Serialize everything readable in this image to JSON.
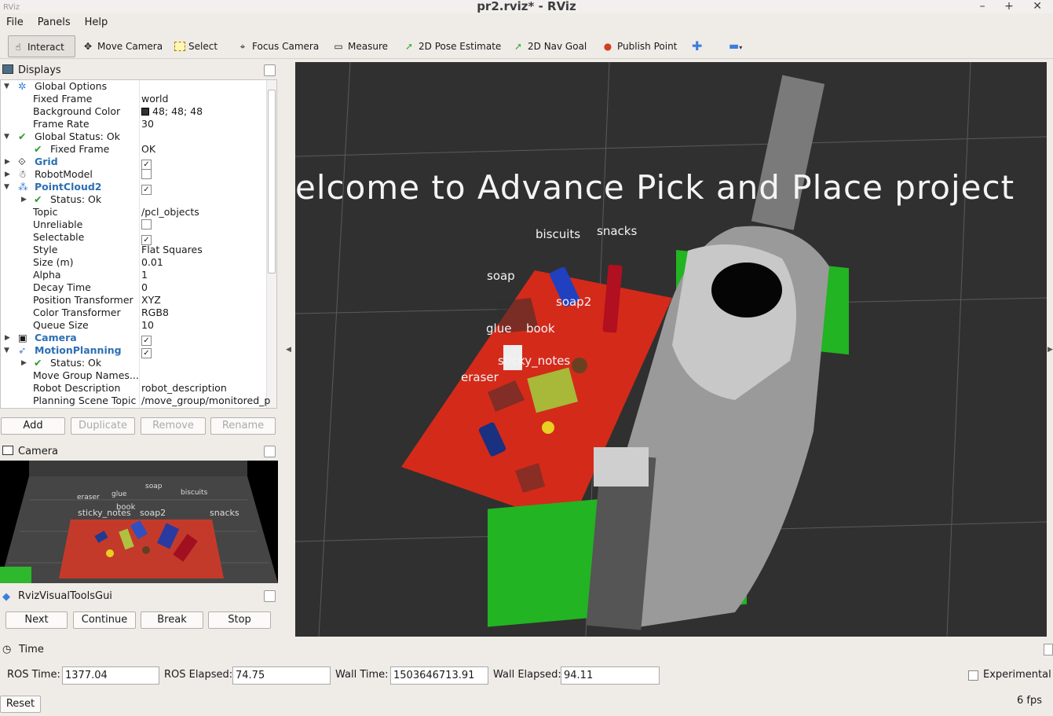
{
  "window": {
    "title": "pr2.rviz* - RViz",
    "controls": "– + ✕"
  },
  "menu": [
    "File",
    "Panels",
    "Help"
  ],
  "toolbar": {
    "interact": "Interact",
    "move_camera": "Move Camera",
    "select": "Select",
    "focus_camera": "Focus Camera",
    "measure": "Measure",
    "pose_estimate": "2D Pose Estimate",
    "nav_goal": "2D Nav Goal",
    "publish_point": "Publish Point"
  },
  "displays": {
    "title": "Displays",
    "rows": [
      {
        "name": "Global Options",
        "value": ""
      },
      {
        "name": "Fixed Frame",
        "value": "world"
      },
      {
        "name": "Background Color",
        "value": "48; 48; 48"
      },
      {
        "name": "Frame Rate",
        "value": "30"
      },
      {
        "name": "Global Status: Ok",
        "value": ""
      },
      {
        "name": "Fixed Frame",
        "value": "OK"
      },
      {
        "name": "Grid",
        "value": ""
      },
      {
        "name": "RobotModel",
        "value": ""
      },
      {
        "name": "PointCloud2",
        "value": ""
      },
      {
        "name": "Status: Ok",
        "value": ""
      },
      {
        "name": "Topic",
        "value": "/pcl_objects"
      },
      {
        "name": "Unreliable",
        "value": ""
      },
      {
        "name": "Selectable",
        "value": ""
      },
      {
        "name": "Style",
        "value": "Flat Squares"
      },
      {
        "name": "Size (m)",
        "value": "0.01"
      },
      {
        "name": "Alpha",
        "value": "1"
      },
      {
        "name": "Decay Time",
        "value": "0"
      },
      {
        "name": "Position Transformer",
        "value": "XYZ"
      },
      {
        "name": "Color Transformer",
        "value": "RGB8"
      },
      {
        "name": "Queue Size",
        "value": "10"
      },
      {
        "name": "Camera",
        "value": ""
      },
      {
        "name": "MotionPlanning",
        "value": ""
      },
      {
        "name": "Status: Ok",
        "value": ""
      },
      {
        "name": "Move Group Names...",
        "value": ""
      },
      {
        "name": "Robot Description",
        "value": "robot_description"
      },
      {
        "name": "Planning Scene Topic",
        "value": "/move_group/monitored_p"
      }
    ],
    "buttons": {
      "add": "Add",
      "duplicate": "Duplicate",
      "remove": "Remove",
      "rename": "Rename"
    }
  },
  "camera_panel": {
    "title": "Camera",
    "labels": {
      "soap": "soap",
      "biscuits": "biscuits",
      "eraser": "eraser",
      "glue": "glue",
      "book": "book",
      "sticky_notes": "sticky_notes",
      "soap2": "soap2",
      "snacks": "snacks"
    }
  },
  "rviz_tools": {
    "title": "RvizVisualToolsGui",
    "next": "Next",
    "continue": "Continue",
    "break": "Break",
    "stop": "Stop"
  },
  "viewport": {
    "banner": "elcome  to  Advance  Pick  and  Place  project",
    "labels": {
      "biscuits": "biscuits",
      "snacks": "snacks",
      "soap": "soap",
      "soap2": "soap2",
      "glue": "glue",
      "book": "book",
      "sticky_notes": "sticky_notes",
      "eraser": "eraser"
    }
  },
  "time": {
    "title": "Time",
    "ros_time_label": "ROS Time:",
    "ros_time": "1377.04",
    "ros_elapsed_label": "ROS Elapsed:",
    "ros_elapsed": "74.75",
    "wall_time_label": "Wall Time:",
    "wall_time": "1503646713.91",
    "wall_elapsed_label": "Wall Elapsed:",
    "wall_elapsed": "94.11",
    "experimental": "Experimental"
  },
  "status": {
    "reset": "Reset",
    "fps": "6 fps"
  }
}
